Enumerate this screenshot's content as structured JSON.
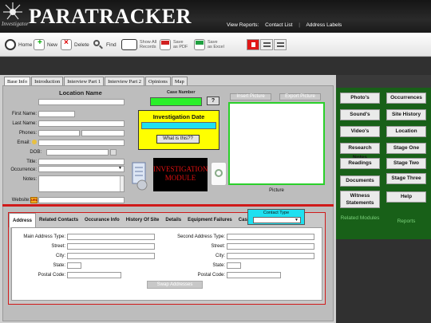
{
  "app": {
    "title": "PARATRACKER",
    "logo_sub": "Investigator",
    "reports_prefix": "View Reports:",
    "reports": [
      "Contact List",
      "Address Labels"
    ]
  },
  "toolbar": {
    "home": "Home",
    "new": "New",
    "delete": "Delete",
    "find": "Find",
    "show_all_1": "Show All",
    "show_all_2": "Records",
    "save_pdf_1": "Save",
    "save_pdf_2": "as PDF",
    "save_excel_1": "Save",
    "save_excel_2": "as Excel"
  },
  "tabs": [
    "Base Info",
    "Introduction",
    "Interview Part 1",
    "Interview Part 2",
    "Opinions",
    "Map"
  ],
  "base_info": {
    "location_name": "Location Name",
    "case_number": "Case Number",
    "question": "?",
    "labels": {
      "first_name": "First Name:",
      "last_name": "Last Name:",
      "phones": "Phones:",
      "email": "Email:",
      "dob": "DOB:",
      "title": "Title:",
      "occurrence": "Occurrence:",
      "notes": "Notes:",
      "website": "Website:"
    },
    "investigation_date": "Investigation Date",
    "what_is_this": "What is this??",
    "module_1": "INVESTIGATION",
    "module_2": "MODULE",
    "insert_picture": "Insert Picture",
    "export_picture": "Export Picture",
    "picture": "Picture",
    "web_icon": "URL"
  },
  "contact_tabs": [
    "Address",
    "Related Contacts",
    "Occurance Info",
    "History Of Site",
    "Details",
    "Equipment Failures",
    "Cases"
  ],
  "contact_type": {
    "label": "Contact Type",
    "value": "▼"
  },
  "address": {
    "main_type": "Main Address Type:",
    "street": "Street:",
    "city": "City:",
    "state": "State:",
    "postal": "Postal Code:",
    "second_type": "Second Address Type:",
    "street2": "Street:",
    "city2": "City:",
    "state2": "State:",
    "postal2": "Postal Code:",
    "swap": "Swap Addresses"
  },
  "right_panel": {
    "left_col": [
      "Photo's",
      "Sound's",
      "Video's",
      "Research Notes",
      "Readings",
      "Documents",
      "Witness Statements"
    ],
    "right_col": [
      "Occurrences",
      "Site History",
      "Location",
      "Stage One",
      "Stage Two",
      "Stage Three",
      "Help"
    ],
    "footer_left": "Related Modules",
    "footer_right": "Reports"
  },
  "colors": {
    "accent_green": "#2bf02b",
    "investigation_yellow": "#ffff00",
    "cyan": "#1ee0f0",
    "red": "#d01a1a",
    "panel_green": "#186018"
  }
}
